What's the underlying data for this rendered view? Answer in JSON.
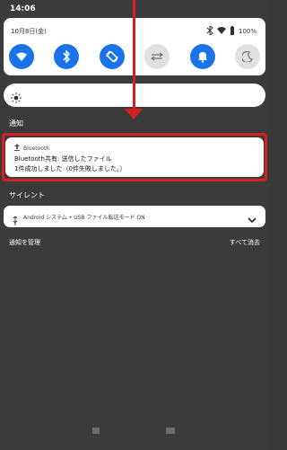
{
  "status_bar": {
    "time": "14:06"
  },
  "quick_settings": {
    "date": "10月8日(金)",
    "battery": "100%",
    "tiles": [
      {
        "icon": "wifi-icon",
        "active": true
      },
      {
        "icon": "bluetooth-icon",
        "active": true
      },
      {
        "icon": "rotate-icon",
        "active": true
      },
      {
        "icon": "data-saver-icon",
        "active": false
      },
      {
        "icon": "bell-icon",
        "active": true
      },
      {
        "icon": "moon-icon",
        "active": false
      }
    ],
    "accent": "#1a73e8"
  },
  "brightness": {
    "icon": "brightness-icon"
  },
  "sections": {
    "notifications": "通知",
    "silent": "サイレント"
  },
  "notification": {
    "app": "Bluetooth",
    "title": "Bluetooth共有: 送信したファイル",
    "body": "1件成功しました（0件失敗しました。）",
    "highlight_color": "#d71f1f"
  },
  "silent_notification": {
    "text": "Android システム • USB ファイル転送モード ON"
  },
  "actions": {
    "manage": "通知を管理",
    "clear_all": "すべて消去"
  }
}
